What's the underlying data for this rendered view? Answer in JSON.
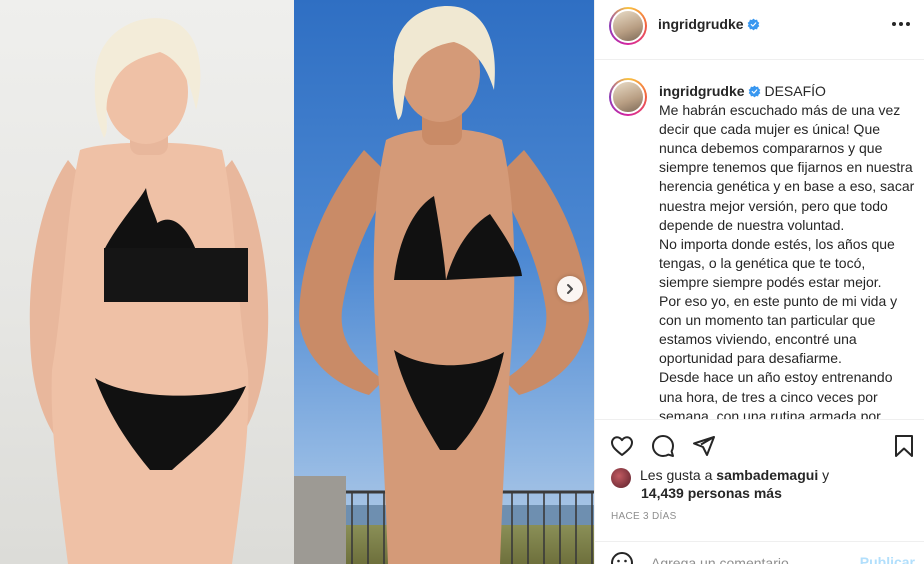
{
  "post": {
    "username": "ingridgrudke",
    "verified": true,
    "caption_title": "DESAFÍO",
    "caption_paragraphs": [
      "Me habrán escuchado más de una vez decir que cada mujer es única! Que nunca debemos compararnos y que siempre tenemos que fijarnos en nuestra herencia genética y en base a eso, sacar nuestra mejor versión, pero que todo depende de nuestra voluntad.",
      "No importa donde estés, los años que tengas, o la genética que te tocó, siempre siempre podés estar mejor.",
      "Por eso yo, en este punto de mi vida y con un momento tan particular que estamos viviendo, encontré una oportunidad para desafiarme.",
      "Desde hace un año estoy entrenando una hora, de tres a cinco veces por semana, con una rutina armada por"
    ],
    "likes_prefix": "Les gusta a",
    "likes_user": "sambademagui",
    "likes_conj": "y",
    "likes_count": "14,439 personas más",
    "time_ago": "HACE 3 DÍAS"
  },
  "comment": {
    "placeholder": "Agrega un comentario...",
    "post_label": "Publicar"
  },
  "colors": {
    "verified": "#3897f0",
    "muted": "#8e8e8e",
    "post_button_disabled": "#b2dffc"
  },
  "icons": [
    "verified-badge-icon",
    "more-options-icon",
    "heart-icon",
    "comment-icon",
    "share-icon",
    "bookmark-icon",
    "emoji-icon",
    "chevron-right-icon"
  ]
}
